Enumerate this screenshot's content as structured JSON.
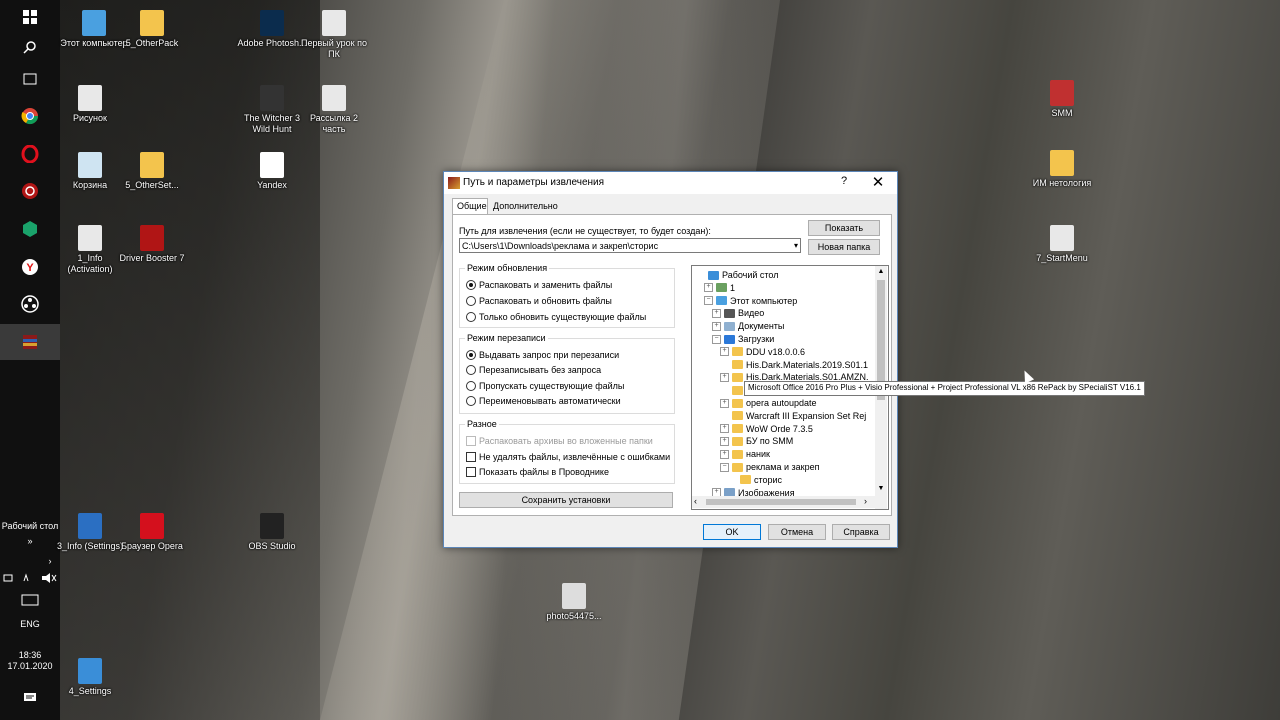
{
  "taskbar": {
    "desktop_label": "Рабочий стол",
    "desktop_sub": "»",
    "lang": "ENG",
    "time": "18:36",
    "date": "17.01.2020"
  },
  "desktop_icons": [
    {
      "label": "Этот компьютер",
      "icon": "computer-icon",
      "color": "#4aa0e0"
    },
    {
      "label": "5_OtherPack",
      "icon": "folder-icon",
      "color": "#f3c44d"
    },
    {
      "label": "Adobe Photosh...",
      "icon": "photoshop-icon",
      "color": "#0b2c4d"
    },
    {
      "label": "Первый урок по ПК",
      "icon": "document-icon",
      "color": "#e8e8e8"
    },
    {
      "label": "Рисунок",
      "icon": "image-icon",
      "color": "#e8e8e8"
    },
    {
      "label": "The Witcher 3 Wild Hunt",
      "icon": "game-icon",
      "color": "#333333"
    },
    {
      "label": "Рассылка 2 часть",
      "icon": "document-icon",
      "color": "#e8e8e8"
    },
    {
      "label": "Корзина",
      "icon": "recycle-bin-icon",
      "color": "#cfe4f2"
    },
    {
      "label": "5_OtherSet...",
      "icon": "folder-icon",
      "color": "#f3c44d"
    },
    {
      "label": "Yandex",
      "icon": "yandex-icon",
      "color": "#ffffff"
    },
    {
      "label": "1_Info (Activation)",
      "icon": "document-icon",
      "color": "#e8e8e8"
    },
    {
      "label": "Driver Booster 7",
      "icon": "driver-booster-icon",
      "color": "#b01515"
    },
    {
      "label": "3_Info (Settings)",
      "icon": "help-icon",
      "color": "#2b6fc2"
    },
    {
      "label": "Браузер Opera",
      "icon": "opera-icon",
      "color": "#d4101d"
    },
    {
      "label": "OBS Studio",
      "icon": "obs-icon",
      "color": "#222222"
    },
    {
      "label": "photo54475...",
      "icon": "image-icon",
      "color": "#dddddd"
    },
    {
      "label": "4_Settings",
      "icon": "settings-icon",
      "color": "#3a8ed8"
    },
    {
      "label": "SMM",
      "icon": "archive-icon",
      "color": "#c03030"
    },
    {
      "label": "ИМ нетология",
      "icon": "folder-icon",
      "color": "#f3c44d"
    },
    {
      "label": "7_StartMenu",
      "icon": "document-icon",
      "color": "#e8e8e8"
    }
  ],
  "dialog": {
    "title": "Путь и параметры извлечения",
    "help": "?",
    "close": "✕",
    "tabs": [
      "Общие",
      "Дополнительно"
    ],
    "path_label": "Путь для извлечения (если не существует, то будет создан):",
    "path_value": "C:\\Users\\1\\Downloads\\реклама и закреп\\сторис",
    "show_button": "Показать",
    "new_folder_button": "Новая папка",
    "update_mode": {
      "title": "Режим обновления",
      "options": [
        "Распаковать и заменить файлы",
        "Распаковать и обновить файлы",
        "Только обновить существующие файлы"
      ],
      "selected": 0
    },
    "overwrite_mode": {
      "title": "Режим перезаписи",
      "options": [
        "Выдавать запрос при перезаписи",
        "Перезаписывать без запроса",
        "Пропускать существующие файлы",
        "Переименовывать автоматически"
      ],
      "selected": 0
    },
    "misc": {
      "title": "Разное",
      "options": [
        "Распаковать архивы во вложенные папки",
        "Не удалять файлы, извлечённые с ошибками",
        "Показать файлы в Проводнике"
      ]
    },
    "save_button": "Сохранить установки",
    "tree": [
      {
        "label": "Рабочий стол",
        "icon": "desktop-icon",
        "level": 0,
        "expander": ""
      },
      {
        "label": "1",
        "icon": "user-icon",
        "level": 1,
        "expander": "+"
      },
      {
        "label": "Этот компьютер",
        "icon": "computer-icon",
        "level": 1,
        "expander": "−"
      },
      {
        "label": "Видео",
        "icon": "video-icon",
        "level": 2,
        "expander": "+"
      },
      {
        "label": "Документы",
        "icon": "documents-icon",
        "level": 2,
        "expander": "+"
      },
      {
        "label": "Загрузки",
        "icon": "downloads-icon",
        "level": 2,
        "expander": "−"
      },
      {
        "label": "DDU v18.0.0.6",
        "icon": "folder-icon",
        "level": 3,
        "expander": "+"
      },
      {
        "label": "His.Dark.Materials.2019.S01.1",
        "icon": "folder-icon",
        "level": 3,
        "expander": ""
      },
      {
        "label": "His.Dark.Materials.S01.AMZN.",
        "icon": "folder-icon",
        "level": 3,
        "expander": "+"
      },
      {
        "label": "",
        "icon": "folder-icon",
        "level": 3,
        "expander": ""
      },
      {
        "label": "opera autoupdate",
        "icon": "folder-icon",
        "level": 3,
        "expander": "+"
      },
      {
        "label": "Warcraft III Expansion Set Rej",
        "icon": "folder-icon",
        "level": 3,
        "expander": ""
      },
      {
        "label": "WoW Orde 7.3.5",
        "icon": "folder-icon",
        "level": 3,
        "expander": "+"
      },
      {
        "label": "БУ по SMM",
        "icon": "folder-icon",
        "level": 3,
        "expander": "+"
      },
      {
        "label": "наник",
        "icon": "folder-icon",
        "level": 3,
        "expander": "+"
      },
      {
        "label": "реклама и закреп",
        "icon": "folder-icon",
        "level": 3,
        "expander": "−"
      },
      {
        "label": "сторис",
        "icon": "folder-icon",
        "level": 4,
        "expander": ""
      },
      {
        "label": "Изображения",
        "icon": "images-icon",
        "level": 2,
        "expander": "+"
      }
    ],
    "tooltip": "Microsoft Office 2016 Pro Plus + Visio Professional + Project Professional VL x86 RePack by SPecialiST V16.1",
    "ok_button": "OK",
    "cancel_button": "Отмена",
    "help_button": "Справка"
  }
}
